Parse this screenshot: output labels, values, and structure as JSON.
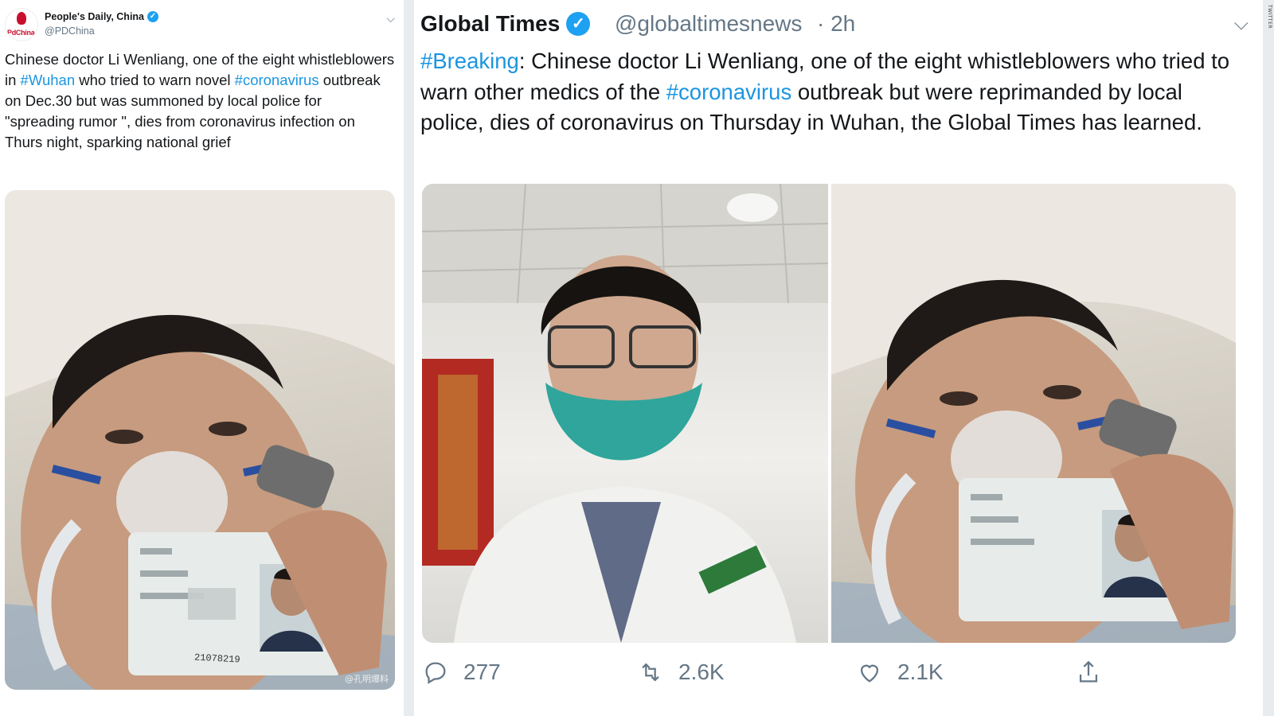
{
  "left_tweet": {
    "display_name": "People's Daily, China",
    "handle": "@PDChina",
    "avatar_text": "PdChina",
    "text_parts": [
      {
        "text": "Chinese doctor Li Wenliang, one of the eight whistleblowers in ",
        "tag": false
      },
      {
        "text": "#Wuhan",
        "tag": true
      },
      {
        "text": " who tried to warn novel ",
        "tag": false
      },
      {
        "text": "#coronavirus",
        "tag": true
      },
      {
        "text": " outbreak on Dec.30 but was summoned by local police for \"spreading rumor \", dies from coronavirus infection on Thurs night, sparking national grief",
        "tag": false
      }
    ]
  },
  "right_tweet": {
    "display_name": "Global Times",
    "handle": "@globaltimesnews",
    "time": "· 2h",
    "text_parts": [
      {
        "text": "#Breaking",
        "tag": true
      },
      {
        "text": ": Chinese doctor Li Wenliang, one of the eight whistleblowers who tried to warn other medics of the ",
        "tag": false
      },
      {
        "text": "#coronavirus",
        "tag": true
      },
      {
        "text": " outbreak but were reprimanded by local police, dies of coronavirus on Thursday in Wuhan, the Global Times has learned.",
        "tag": false
      }
    ],
    "actions": {
      "replies": "277",
      "retweets": "2.6K",
      "likes": "2.1K"
    }
  },
  "image_text": {
    "id_number": "21078219",
    "weibo_mark": "@孔明爆料"
  },
  "watermark": "TWITTER",
  "colors": {
    "link": "#1b95e0",
    "verified": "#1da1f2",
    "text": "#14171a",
    "muted": "#657786"
  },
  "icons": [
    "verified-badge-icon",
    "chevron-down-icon",
    "reply-icon",
    "retweet-icon",
    "like-icon",
    "share-icon"
  ]
}
